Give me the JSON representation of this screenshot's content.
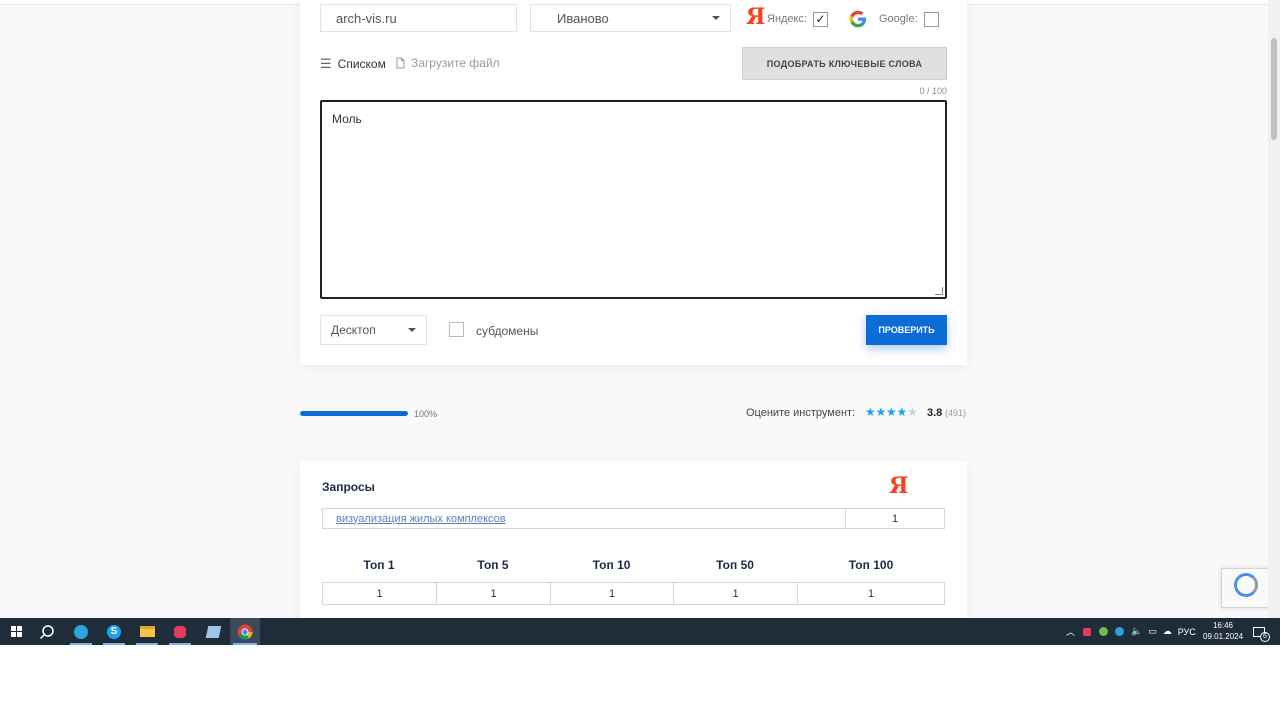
{
  "form": {
    "domain_value": "arch-vis.ru",
    "region_value": "Иваново",
    "yandex_logo": "Я",
    "yandex_label": "Яндекс:",
    "yandex_checked_mark": "✓",
    "google_label": "Google:",
    "tab_list": "Списком",
    "tab_upload": "Загрузите файл",
    "suggest_button": "ПОДОБРАТЬ КЛЮЧЕВЫЕ СЛОВА",
    "counter": "0 / 100",
    "keywords_value": "Моль",
    "device_value": "Десктоп",
    "subdomains_label": "субдомены",
    "check_button": "ПРОВЕРИТЬ"
  },
  "progress": {
    "percent_text": "100%",
    "fraction": 1.0
  },
  "rating": {
    "label": "Оцените инструмент:",
    "value": "3.8",
    "count": "(491)",
    "stars_filled": 4,
    "stars_total": 5
  },
  "results": {
    "title": "Запросы",
    "engine_logo": "Я",
    "rows": [
      {
        "query": "визуализация жилых комплексов",
        "position": "1"
      }
    ],
    "top_headers": [
      "Топ 1",
      "Топ 5",
      "Топ 10",
      "Топ 50",
      "Топ 100"
    ],
    "top_values": [
      "1",
      "1",
      "1",
      "1",
      "1"
    ]
  },
  "taskbar": {
    "language": "РУС",
    "time": "16:46",
    "date": "09.01.2024",
    "notifications_count": "6"
  },
  "colors": {
    "accent": "#0b6cd6",
    "yandex": "#fc3f1d",
    "star": "#1aa3e8",
    "taskbar": "#1f2d3a"
  }
}
